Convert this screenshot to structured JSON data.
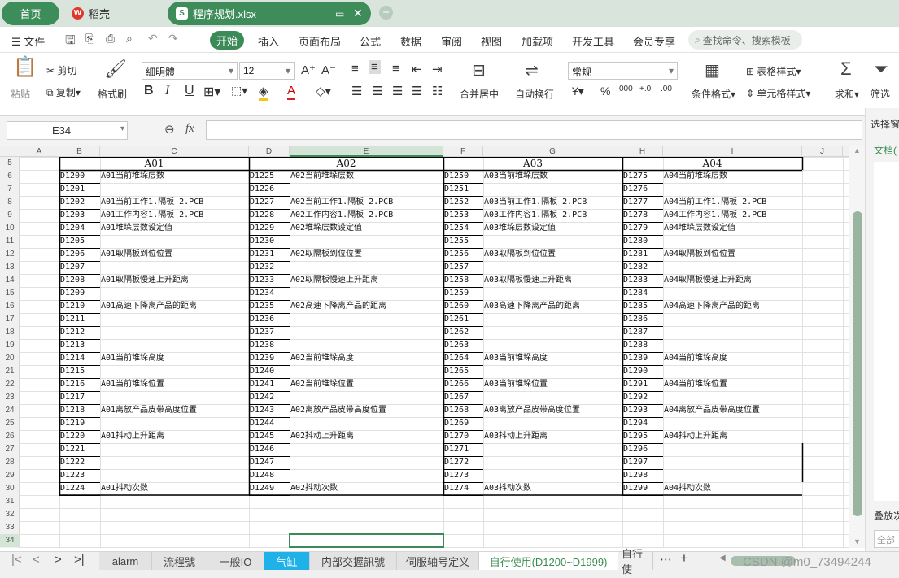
{
  "tabs": {
    "home": "首页",
    "daoke": "稻壳",
    "file": "程序规划.xlsx"
  },
  "menu": {
    "file": "文件",
    "start": "开始",
    "insert": "插入",
    "layout": "页面布局",
    "formula": "公式",
    "data": "数据",
    "review": "审阅",
    "view": "视图",
    "addons": "加载项",
    "devtools": "开发工具",
    "member": "会员专享",
    "search": "查找命令、搜索模板"
  },
  "ribbon": {
    "paste": "粘贴",
    "cut": "剪切",
    "copy": "复制",
    "format_painter": "格式刷",
    "font_name": "細明體",
    "font_size": "12",
    "merge": "合并居中",
    "wrap": "自动换行",
    "number_format": "常规",
    "currency": "¥",
    "percent": "%",
    "thousands": "000",
    "dec_inc": "+.0",
    "dec_dec": ".00",
    "cond_format": "条件格式",
    "table_style": "表格样式",
    "cell_style": "单元格样式",
    "sum": "求和",
    "filter": "筛选"
  },
  "formula_bar": {
    "cell_ref": "E34",
    "fx": "fx",
    "value": ""
  },
  "right_panel": {
    "select": "选择窗",
    "doc": "文档(",
    "overlay": "叠放次",
    "all": "全部"
  },
  "columns": [
    "A",
    "B",
    "C",
    "D",
    "E",
    "F",
    "G",
    "H",
    "I",
    "J"
  ],
  "rows": [
    "5",
    "6",
    "7",
    "8",
    "9",
    "10",
    "11",
    "12",
    "13",
    "14",
    "15",
    "16",
    "17",
    "18",
    "19",
    "20",
    "21",
    "22",
    "23",
    "24",
    "25",
    "26",
    "27",
    "28",
    "29",
    "30",
    "31",
    "32",
    "33",
    "34"
  ],
  "headers": [
    "A01",
    "A02",
    "A03",
    "A04"
  ],
  "sheet": [
    [
      [
        "D1200",
        "A01当前堆垛层数"
      ],
      [
        "D1225",
        "A02当前堆垛层数"
      ],
      [
        "D1250",
        "A03当前堆垛层数"
      ],
      [
        "D1275",
        "A04当前堆垛层数"
      ]
    ],
    [
      [
        "D1201",
        ""
      ],
      [
        "D1226",
        ""
      ],
      [
        "D1251",
        ""
      ],
      [
        "D1276",
        ""
      ]
    ],
    [
      [
        "D1202",
        "A01当前工作1.隔板 2.PCB"
      ],
      [
        "D1227",
        "A02当前工作1.隔板 2.PCB"
      ],
      [
        "D1252",
        "A03当前工作1.隔板 2.PCB"
      ],
      [
        "D1277",
        "A04当前工作1.隔板 2.PCB"
      ]
    ],
    [
      [
        "D1203",
        "A01工作内容1.隔板 2.PCB"
      ],
      [
        "D1228",
        "A02工作内容1.隔板 2.PCB"
      ],
      [
        "D1253",
        "A03工作内容1.隔板 2.PCB"
      ],
      [
        "D1278",
        "A04工作内容1.隔板 2.PCB"
      ]
    ],
    [
      [
        "D1204",
        "A01堆垛层数设定值"
      ],
      [
        "D1229",
        "A02堆垛层数设定值"
      ],
      [
        "D1254",
        "A03堆垛层数设定值"
      ],
      [
        "D1279",
        "A04堆垛层数设定值"
      ]
    ],
    [
      [
        "D1205",
        ""
      ],
      [
        "D1230",
        ""
      ],
      [
        "D1255",
        ""
      ],
      [
        "D1280",
        ""
      ]
    ],
    [
      [
        "D1206",
        "A01取隔板到位位置"
      ],
      [
        "D1231",
        "A02取隔板到位位置"
      ],
      [
        "D1256",
        "A03取隔板到位位置"
      ],
      [
        "D1281",
        "A04取隔板到位位置"
      ]
    ],
    [
      [
        "D1207",
        ""
      ],
      [
        "D1232",
        ""
      ],
      [
        "D1257",
        ""
      ],
      [
        "D1282",
        ""
      ]
    ],
    [
      [
        "D1208",
        "A01取隔板慢速上升距离"
      ],
      [
        "D1233",
        "A02取隔板慢速上升距离"
      ],
      [
        "D1258",
        "A03取隔板慢速上升距离"
      ],
      [
        "D1283",
        "A04取隔板慢速上升距离"
      ]
    ],
    [
      [
        "D1209",
        ""
      ],
      [
        "D1234",
        ""
      ],
      [
        "D1259",
        ""
      ],
      [
        "D1284",
        ""
      ]
    ],
    [
      [
        "D1210",
        "A01高速下降离产品的距离"
      ],
      [
        "D1235",
        "A02高速下降离产品的距离"
      ],
      [
        "D1260",
        "A03高速下降离产品的距离"
      ],
      [
        "D1285",
        "A04高速下降离产品的距离"
      ]
    ],
    [
      [
        "D1211",
        ""
      ],
      [
        "D1236",
        ""
      ],
      [
        "D1261",
        ""
      ],
      [
        "D1286",
        ""
      ]
    ],
    [
      [
        "D1212",
        ""
      ],
      [
        "D1237",
        ""
      ],
      [
        "D1262",
        ""
      ],
      [
        "D1287",
        ""
      ]
    ],
    [
      [
        "D1213",
        ""
      ],
      [
        "D1238",
        ""
      ],
      [
        "D1263",
        ""
      ],
      [
        "D1288",
        ""
      ]
    ],
    [
      [
        "D1214",
        "A01当前堆垛高度"
      ],
      [
        "D1239",
        "A02当前堆垛高度"
      ],
      [
        "D1264",
        "A03当前堆垛高度"
      ],
      [
        "D1289",
        "A04当前堆垛高度"
      ]
    ],
    [
      [
        "D1215",
        ""
      ],
      [
        "D1240",
        ""
      ],
      [
        "D1265",
        ""
      ],
      [
        "D1290",
        ""
      ]
    ],
    [
      [
        "D1216",
        "A01当前堆垛位置"
      ],
      [
        "D1241",
        "A02当前堆垛位置"
      ],
      [
        "D1266",
        "A03当前堆垛位置"
      ],
      [
        "D1291",
        "A04当前堆垛位置"
      ]
    ],
    [
      [
        "D1217",
        ""
      ],
      [
        "D1242",
        ""
      ],
      [
        "D1267",
        ""
      ],
      [
        "D1292",
        ""
      ]
    ],
    [
      [
        "D1218",
        "A01离放产品皮带高度位置"
      ],
      [
        "D1243",
        "A02离放产品皮带高度位置"
      ],
      [
        "D1268",
        "A03离放产品皮带高度位置"
      ],
      [
        "D1293",
        "A04离放产品皮带高度位置"
      ]
    ],
    [
      [
        "D1219",
        ""
      ],
      [
        "D1244",
        ""
      ],
      [
        "D1269",
        ""
      ],
      [
        "D1294",
        ""
      ]
    ],
    [
      [
        "D1220",
        "A01抖动上升距离"
      ],
      [
        "D1245",
        "A02抖动上升距离"
      ],
      [
        "D1270",
        "A03抖动上升距离"
      ],
      [
        "D1295",
        "A04抖动上升距离"
      ]
    ],
    [
      [
        "D1221",
        ""
      ],
      [
        "D1246",
        ""
      ],
      [
        "D1271",
        ""
      ],
      [
        "D1296",
        ""
      ]
    ],
    [
      [
        "D1222",
        ""
      ],
      [
        "D1247",
        ""
      ],
      [
        "D1272",
        ""
      ],
      [
        "D1297",
        ""
      ]
    ],
    [
      [
        "D1223",
        ""
      ],
      [
        "D1248",
        ""
      ],
      [
        "D1273",
        ""
      ],
      [
        "D1298",
        ""
      ]
    ],
    [
      [
        "D1224",
        "A01抖动次数"
      ],
      [
        "D1249",
        "A02抖动次数"
      ],
      [
        "D1274",
        "A03抖动次数"
      ],
      [
        "D1299",
        "A04抖动次数"
      ]
    ]
  ],
  "sheet_tabs": [
    "alarm",
    "流程號",
    "一般IO",
    "气缸",
    "内部交握訊號",
    "伺服轴号定义",
    "自行使用(D1200~D1999)",
    "自行使"
  ],
  "watermark": "CSDN @m0_73494244",
  "colors": {
    "accent": "#3b8a57",
    "active_tab_text": "#3a8c4e",
    "cyan_tab": "#1fb2e8"
  }
}
